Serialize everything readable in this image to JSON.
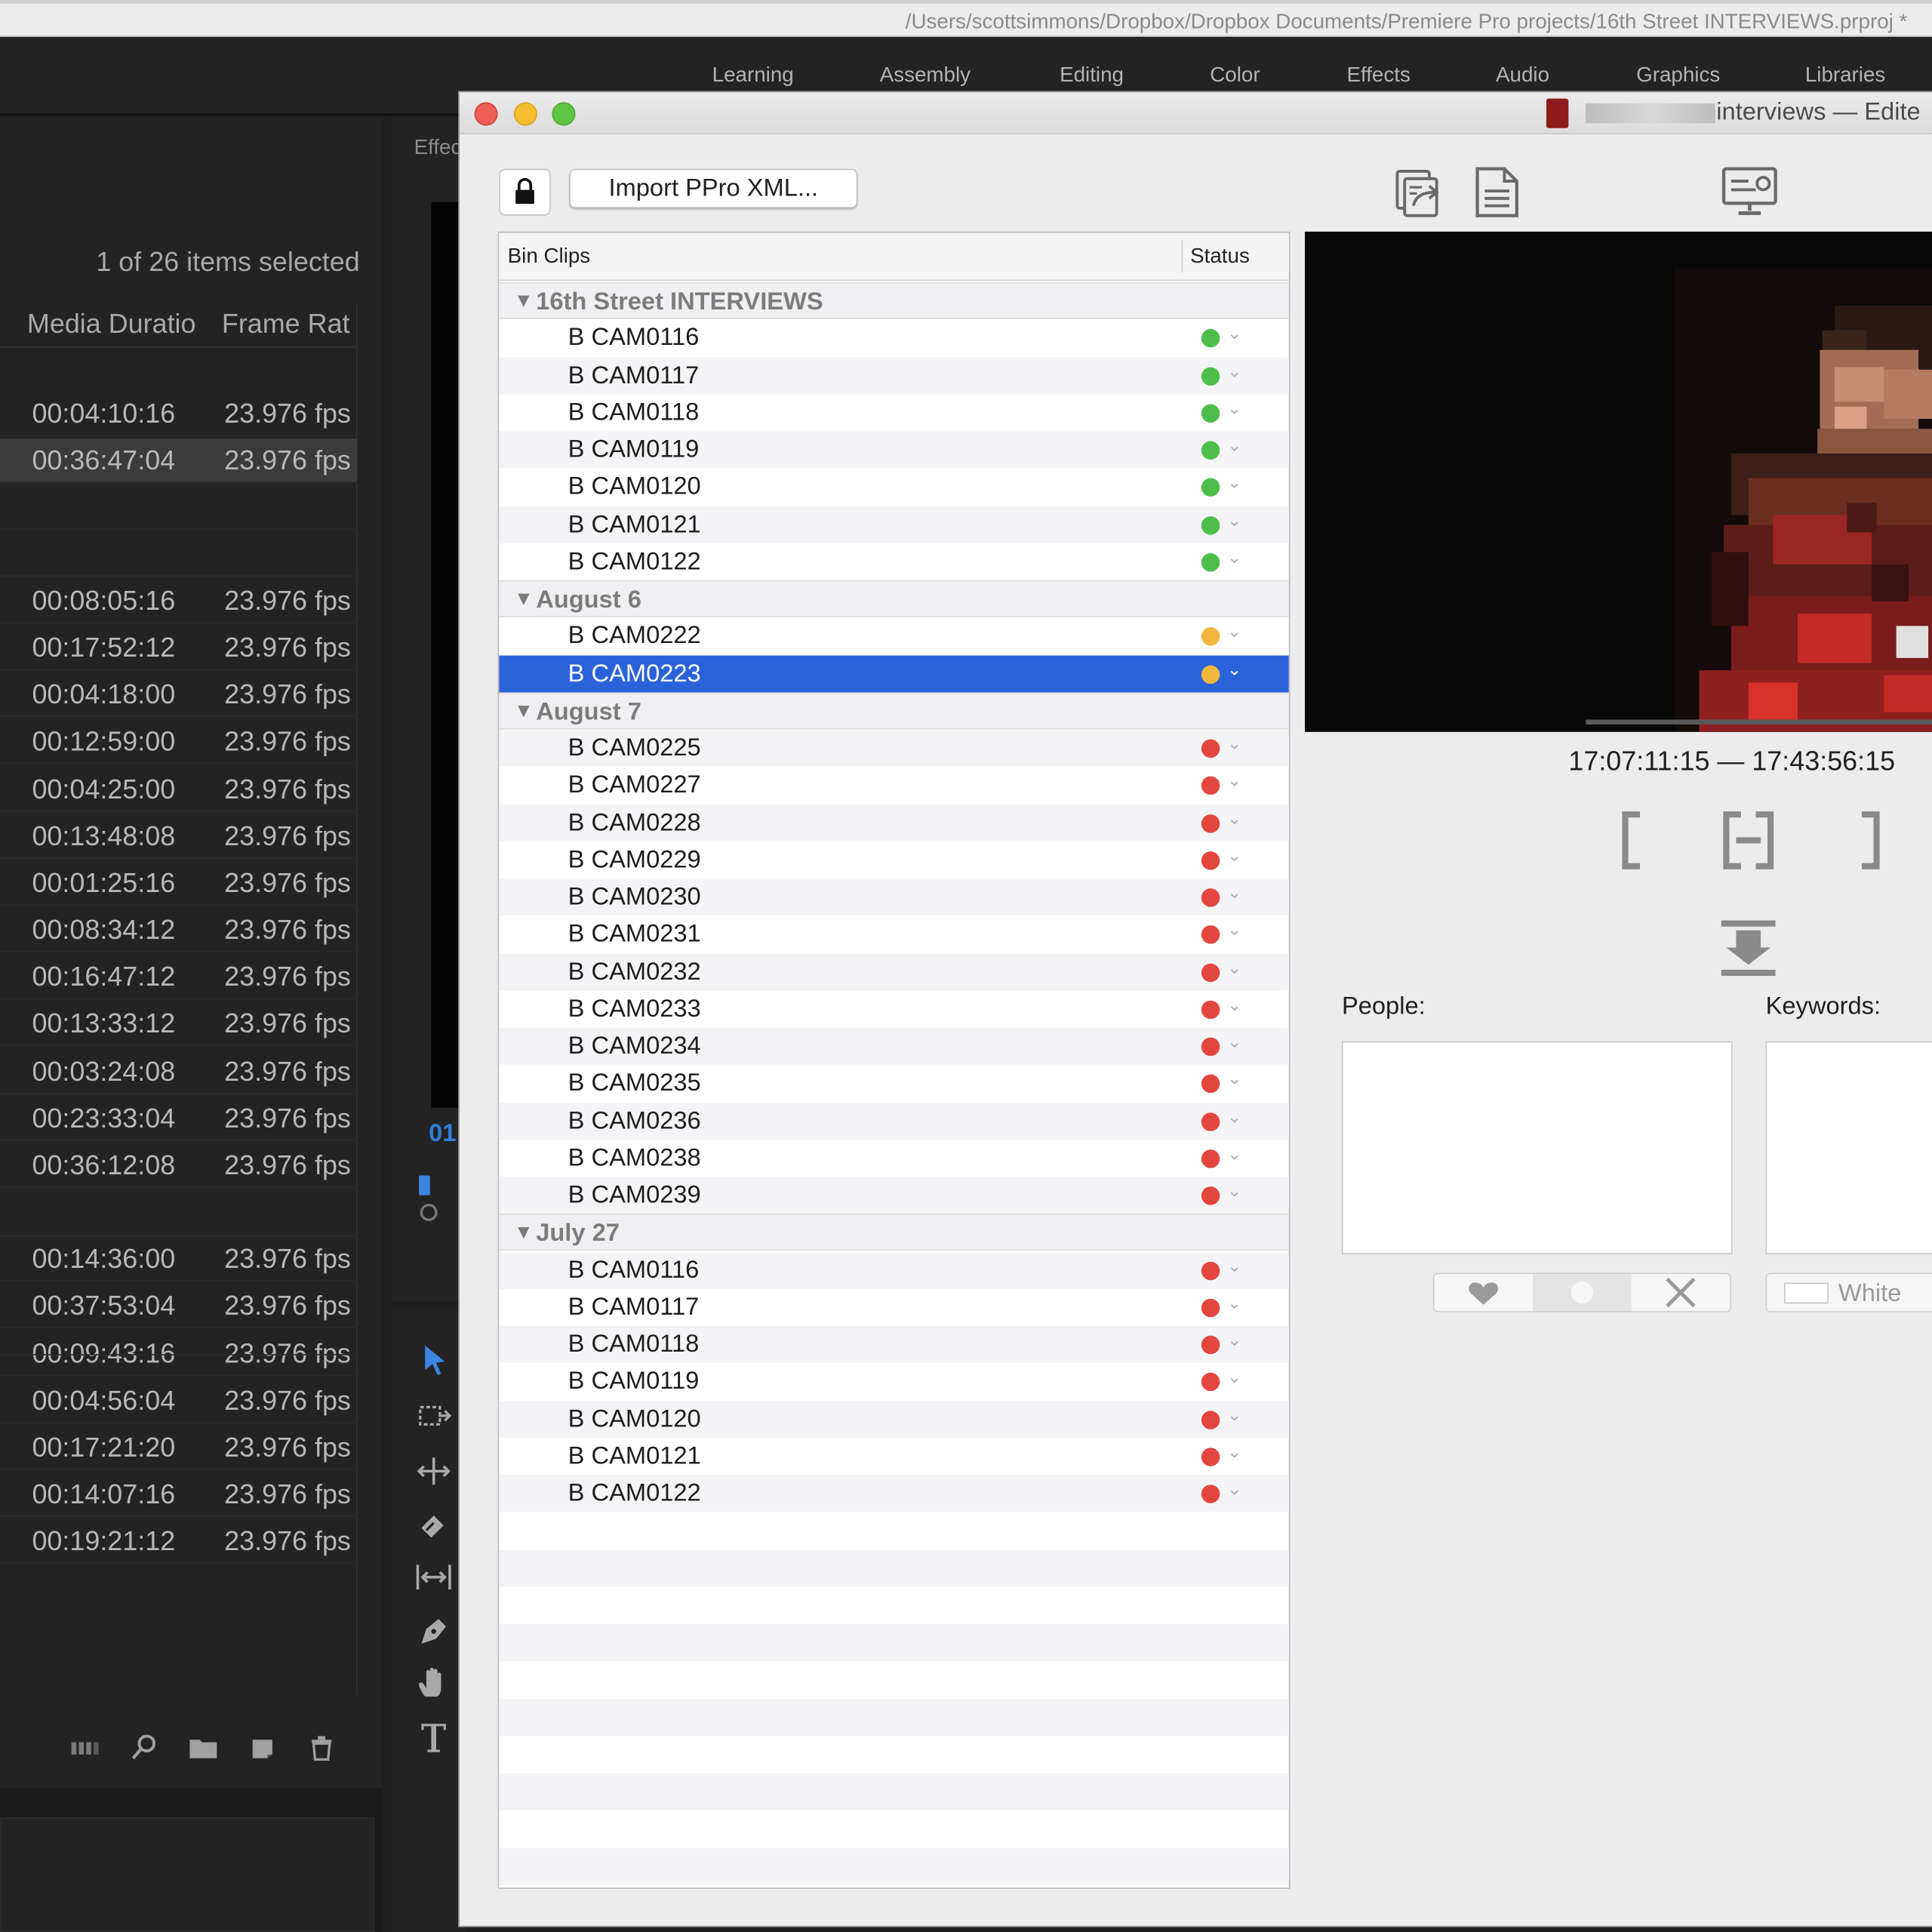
{
  "system": {
    "path": "/Users/scottsimmons/Dropbox/Dropbox Documents/Premiere Pro projects/16th Street INTERVIEWS.prproj *"
  },
  "workspaces": [
    "Learning",
    "Assembly",
    "Editing",
    "Color",
    "Effects",
    "Audio",
    "Graphics",
    "Libraries"
  ],
  "project": {
    "selection_info": "1 of 26 items selected",
    "col_duration": "Media Duratio",
    "col_framerate": "Frame Rat",
    "rows": [
      {
        "duration": "00:04:10:16",
        "fps": "23.976 fps"
      },
      {
        "duration": "00:36:47:04",
        "fps": "23.976 fps"
      },
      {
        "duration": "00:08:05:16",
        "fps": "23.976 fps"
      },
      {
        "duration": "00:17:52:12",
        "fps": "23.976 fps"
      },
      {
        "duration": "00:04:18:00",
        "fps": "23.976 fps"
      },
      {
        "duration": "00:12:59:00",
        "fps": "23.976 fps"
      },
      {
        "duration": "00:04:25:00",
        "fps": "23.976 fps"
      },
      {
        "duration": "00:13:48:08",
        "fps": "23.976 fps"
      },
      {
        "duration": "00:01:25:16",
        "fps": "23.976 fps"
      },
      {
        "duration": "00:08:34:12",
        "fps": "23.976 fps"
      },
      {
        "duration": "00:16:47:12",
        "fps": "23.976 fps"
      },
      {
        "duration": "00:13:33:12",
        "fps": "23.976 fps"
      },
      {
        "duration": "00:03:24:08",
        "fps": "23.976 fps"
      },
      {
        "duration": "00:23:33:04",
        "fps": "23.976 fps"
      },
      {
        "duration": "00:36:12:08",
        "fps": "23.976 fps"
      },
      {
        "duration": "00:14:36:00",
        "fps": "23.976 fps"
      },
      {
        "duration": "00:37:53:04",
        "fps": "23.976 fps"
      },
      {
        "duration": "00:09:43:16",
        "fps": "23.976 fps"
      },
      {
        "duration": "00:04:56:04",
        "fps": "23.976 fps"
      },
      {
        "duration": "00:17:21:20",
        "fps": "23.976 fps"
      },
      {
        "duration": "00:14:07:16",
        "fps": "23.976 fps"
      },
      {
        "duration": "00:19:21:12",
        "fps": "23.976 fps"
      }
    ]
  },
  "middle": {
    "tab": "Effec",
    "timecode": "01"
  },
  "window": {
    "title": "interviews — Edite",
    "import_button": "Import PPro XML...",
    "table": {
      "col_clips": "Bin Clips",
      "col_status": "Status",
      "groups": [
        {
          "name": "16th Street INTERVIEWS",
          "clips": [
            {
              "name": "B CAM0116",
              "status": "green"
            },
            {
              "name": "B CAM0117",
              "status": "green"
            },
            {
              "name": "B CAM0118",
              "status": "green"
            },
            {
              "name": "B CAM0119",
              "status": "green"
            },
            {
              "name": "B CAM0120",
              "status": "green"
            },
            {
              "name": "B CAM0121",
              "status": "green"
            },
            {
              "name": "B CAM0122",
              "status": "green"
            }
          ]
        },
        {
          "name": "August 6",
          "clips": [
            {
              "name": "B CAM0222",
              "status": "yellow"
            },
            {
              "name": "B CAM0223",
              "status": "yellow",
              "selected": true
            }
          ]
        },
        {
          "name": "August 7",
          "clips": [
            {
              "name": "B CAM0225",
              "status": "red"
            },
            {
              "name": "B CAM0227",
              "status": "red"
            },
            {
              "name": "B CAM0228",
              "status": "red"
            },
            {
              "name": "B CAM0229",
              "status": "red"
            },
            {
              "name": "B CAM0230",
              "status": "red"
            },
            {
              "name": "B CAM0231",
              "status": "red"
            },
            {
              "name": "B CAM0232",
              "status": "red"
            },
            {
              "name": "B CAM0233",
              "status": "red"
            },
            {
              "name": "B CAM0234",
              "status": "red"
            },
            {
              "name": "B CAM0235",
              "status": "red"
            },
            {
              "name": "B CAM0236",
              "status": "red"
            },
            {
              "name": "B CAM0238",
              "status": "red"
            },
            {
              "name": "B CAM0239",
              "status": "red"
            }
          ]
        },
        {
          "name": "July 27",
          "clips": [
            {
              "name": "B CAM0116",
              "status": "red"
            },
            {
              "name": "B CAM0117",
              "status": "red"
            },
            {
              "name": "B CAM0118",
              "status": "red"
            },
            {
              "name": "B CAM0119",
              "status": "red"
            },
            {
              "name": "B CAM0120",
              "status": "red"
            },
            {
              "name": "B CAM0121",
              "status": "red"
            },
            {
              "name": "B CAM0122",
              "status": "red"
            }
          ]
        }
      ]
    },
    "timecode_range": "17:07:11:15 — 17:43:56:15",
    "people_label": "People:",
    "keywords_label": "Keywords:",
    "color_button": "White"
  },
  "colors": {
    "green": "#4cbf4a",
    "yellow": "#f1b63c",
    "red": "#e3463f",
    "selection": "#2a62d9"
  }
}
